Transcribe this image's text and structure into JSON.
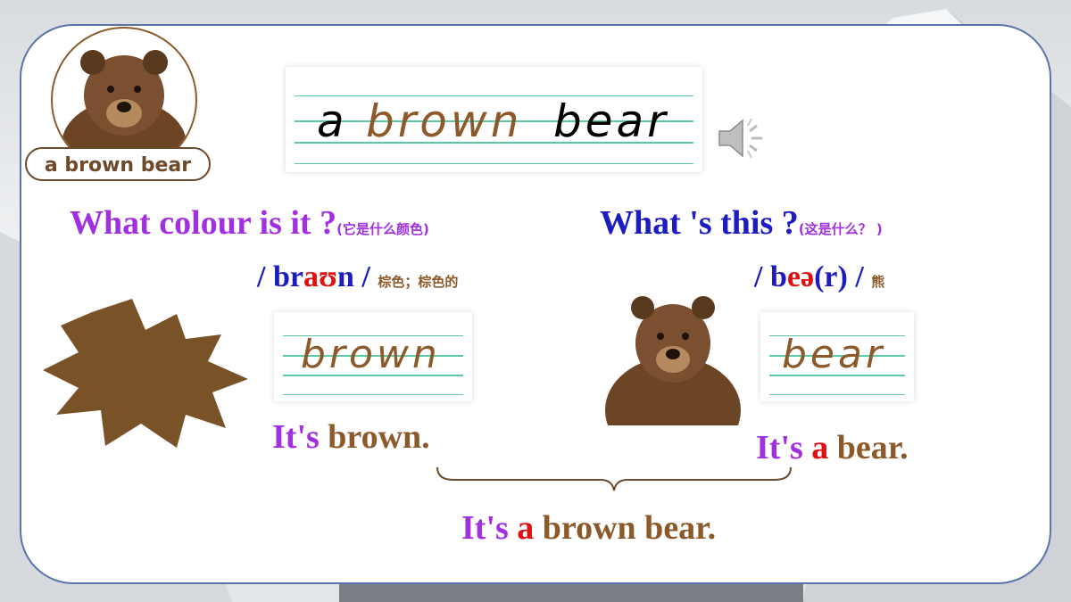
{
  "tag_label": "a brown bear",
  "writing_main": {
    "word1": "a",
    "word2": "brown",
    "word3": "bear"
  },
  "question_left": {
    "text": "What colour is it ?",
    "cn": "(它是什么颜色)"
  },
  "question_right": {
    "text": "What 's this ?",
    "cn": "(这是什么？ )"
  },
  "ipa_brown": {
    "slash_open": "/ ",
    "p1": "br",
    "p2": "aʊ",
    "p3": "n",
    "slash_close": " /",
    "cn": "棕色；棕色的"
  },
  "ipa_bear": {
    "slash_open": "/ ",
    "p1": "b",
    "p2": "eə",
    "p3": "(r)",
    "slash_close": " /",
    "cn": "熊"
  },
  "writing_brown": "brown",
  "writing_bear": "bear",
  "sentence_brown": {
    "its": "It's",
    "rest": " brown."
  },
  "sentence_bear": {
    "its": "It's",
    "a": " a",
    "rest": " bear."
  },
  "sentence_final": {
    "its": "It's",
    "a": " a",
    "rest": " brown bear."
  },
  "colors": {
    "brown": "#8c5a2a",
    "purple": "#a030e0",
    "blue": "#1c1cc0",
    "red": "#e01010",
    "border": "#5a73a8"
  },
  "icons": [
    "speaker-icon",
    "brown-star-shape",
    "bear-photo"
  ]
}
